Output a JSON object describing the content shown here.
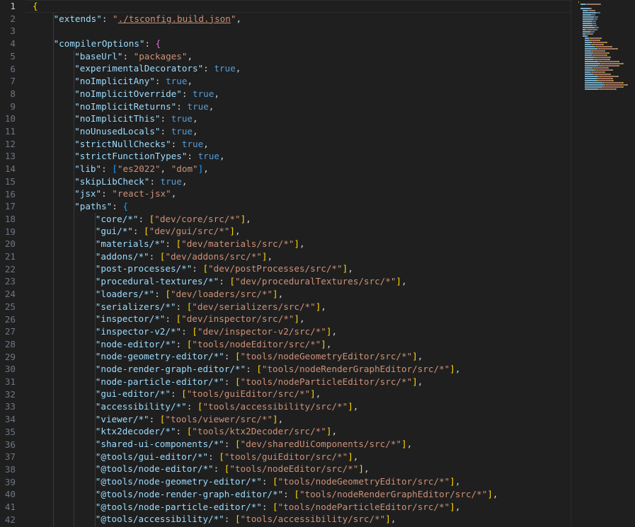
{
  "editor": {
    "active_line": 1,
    "lines": [
      {
        "n": "1",
        "indent": 0,
        "parts": [
          [
            "br1",
            "{"
          ]
        ]
      },
      {
        "n": "2",
        "indent": 1,
        "parts": [
          [
            "k",
            "\"extends\""
          ],
          [
            "p",
            ": "
          ],
          [
            "s",
            "\""
          ],
          [
            "su",
            "./tsconfig.build.json"
          ],
          [
            "s",
            "\""
          ],
          [
            "p",
            ","
          ]
        ]
      },
      {
        "n": "3",
        "indent": 0,
        "parts": []
      },
      {
        "n": "4",
        "indent": 1,
        "parts": [
          [
            "k",
            "\"compilerOptions\""
          ],
          [
            "p",
            ": "
          ],
          [
            "br2",
            "{"
          ]
        ]
      },
      {
        "n": "5",
        "indent": 2,
        "parts": [
          [
            "k",
            "\"baseUrl\""
          ],
          [
            "p",
            ": "
          ],
          [
            "s",
            "\"packages\""
          ],
          [
            "p",
            ","
          ]
        ]
      },
      {
        "n": "6",
        "indent": 2,
        "parts": [
          [
            "k",
            "\"experimentalDecorators\""
          ],
          [
            "p",
            ": "
          ],
          [
            "b",
            "true"
          ],
          [
            "p",
            ","
          ]
        ]
      },
      {
        "n": "7",
        "indent": 2,
        "parts": [
          [
            "k",
            "\"noImplicitAny\""
          ],
          [
            "p",
            ": "
          ],
          [
            "b",
            "true"
          ],
          [
            "p",
            ","
          ]
        ]
      },
      {
        "n": "8",
        "indent": 2,
        "parts": [
          [
            "k",
            "\"noImplicitOverride\""
          ],
          [
            "p",
            ": "
          ],
          [
            "b",
            "true"
          ],
          [
            "p",
            ","
          ]
        ]
      },
      {
        "n": "9",
        "indent": 2,
        "parts": [
          [
            "k",
            "\"noImplicitReturns\""
          ],
          [
            "p",
            ": "
          ],
          [
            "b",
            "true"
          ],
          [
            "p",
            ","
          ]
        ]
      },
      {
        "n": "10",
        "indent": 2,
        "parts": [
          [
            "k",
            "\"noImplicitThis\""
          ],
          [
            "p",
            ": "
          ],
          [
            "b",
            "true"
          ],
          [
            "p",
            ","
          ]
        ]
      },
      {
        "n": "11",
        "indent": 2,
        "parts": [
          [
            "k",
            "\"noUnusedLocals\""
          ],
          [
            "p",
            ": "
          ],
          [
            "b",
            "true"
          ],
          [
            "p",
            ","
          ]
        ]
      },
      {
        "n": "12",
        "indent": 2,
        "parts": [
          [
            "k",
            "\"strictNullChecks\""
          ],
          [
            "p",
            ": "
          ],
          [
            "b",
            "true"
          ],
          [
            "p",
            ","
          ]
        ]
      },
      {
        "n": "13",
        "indent": 2,
        "parts": [
          [
            "k",
            "\"strictFunctionTypes\""
          ],
          [
            "p",
            ": "
          ],
          [
            "b",
            "true"
          ],
          [
            "p",
            ","
          ]
        ]
      },
      {
        "n": "14",
        "indent": 2,
        "parts": [
          [
            "k",
            "\"lib\""
          ],
          [
            "p",
            ": "
          ],
          [
            "br3",
            "["
          ],
          [
            "s",
            "\"es2022\""
          ],
          [
            "p",
            ", "
          ],
          [
            "s",
            "\"dom\""
          ],
          [
            "br3",
            "]"
          ],
          [
            "p",
            ","
          ]
        ]
      },
      {
        "n": "15",
        "indent": 2,
        "parts": [
          [
            "k",
            "\"skipLibCheck\""
          ],
          [
            "p",
            ": "
          ],
          [
            "b",
            "true"
          ],
          [
            "p",
            ","
          ]
        ]
      },
      {
        "n": "16",
        "indent": 2,
        "parts": [
          [
            "k",
            "\"jsx\""
          ],
          [
            "p",
            ": "
          ],
          [
            "s",
            "\"react-jsx\""
          ],
          [
            "p",
            ","
          ]
        ]
      },
      {
        "n": "17",
        "indent": 2,
        "parts": [
          [
            "k",
            "\"paths\""
          ],
          [
            "p",
            ": "
          ],
          [
            "br3",
            "{"
          ]
        ]
      },
      {
        "n": "18",
        "indent": 3,
        "parts": [
          [
            "k",
            "\"core/*\""
          ],
          [
            "p",
            ": "
          ],
          [
            "br1",
            "["
          ],
          [
            "s",
            "\"dev/core/src/*\""
          ],
          [
            "br1",
            "]"
          ],
          [
            "p",
            ","
          ]
        ]
      },
      {
        "n": "19",
        "indent": 3,
        "parts": [
          [
            "k",
            "\"gui/*\""
          ],
          [
            "p",
            ": "
          ],
          [
            "br1",
            "["
          ],
          [
            "s",
            "\"dev/gui/src/*\""
          ],
          [
            "br1",
            "]"
          ],
          [
            "p",
            ","
          ]
        ]
      },
      {
        "n": "20",
        "indent": 3,
        "parts": [
          [
            "k",
            "\"materials/*\""
          ],
          [
            "p",
            ": "
          ],
          [
            "br1",
            "["
          ],
          [
            "s",
            "\"dev/materials/src/*\""
          ],
          [
            "br1",
            "]"
          ],
          [
            "p",
            ","
          ]
        ]
      },
      {
        "n": "21",
        "indent": 3,
        "parts": [
          [
            "k",
            "\"addons/*\""
          ],
          [
            "p",
            ": "
          ],
          [
            "br1",
            "["
          ],
          [
            "s",
            "\"dev/addons/src/*\""
          ],
          [
            "br1",
            "]"
          ],
          [
            "p",
            ","
          ]
        ]
      },
      {
        "n": "22",
        "indent": 3,
        "parts": [
          [
            "k",
            "\"post-processes/*\""
          ],
          [
            "p",
            ": "
          ],
          [
            "br1",
            "["
          ],
          [
            "s",
            "\"dev/postProcesses/src/*\""
          ],
          [
            "br1",
            "]"
          ],
          [
            "p",
            ","
          ]
        ]
      },
      {
        "n": "23",
        "indent": 3,
        "parts": [
          [
            "k",
            "\"procedural-textures/*\""
          ],
          [
            "p",
            ": "
          ],
          [
            "br1",
            "["
          ],
          [
            "s",
            "\"dev/proceduralTextures/src/*\""
          ],
          [
            "br1",
            "]"
          ],
          [
            "p",
            ","
          ]
        ]
      },
      {
        "n": "24",
        "indent": 3,
        "parts": [
          [
            "k",
            "\"loaders/*\""
          ],
          [
            "p",
            ": "
          ],
          [
            "br1",
            "["
          ],
          [
            "s",
            "\"dev/loaders/src/*\""
          ],
          [
            "br1",
            "]"
          ],
          [
            "p",
            ","
          ]
        ]
      },
      {
        "n": "25",
        "indent": 3,
        "parts": [
          [
            "k",
            "\"serializers/*\""
          ],
          [
            "p",
            ": "
          ],
          [
            "br1",
            "["
          ],
          [
            "s",
            "\"dev/serializers/src/*\""
          ],
          [
            "br1",
            "]"
          ],
          [
            "p",
            ","
          ]
        ]
      },
      {
        "n": "26",
        "indent": 3,
        "parts": [
          [
            "k",
            "\"inspector/*\""
          ],
          [
            "p",
            ": "
          ],
          [
            "br1",
            "["
          ],
          [
            "s",
            "\"dev/inspector/src/*\""
          ],
          [
            "br1",
            "]"
          ],
          [
            "p",
            ","
          ]
        ]
      },
      {
        "n": "27",
        "indent": 3,
        "parts": [
          [
            "k",
            "\"inspector-v2/*\""
          ],
          [
            "p",
            ": "
          ],
          [
            "br1",
            "["
          ],
          [
            "s",
            "\"dev/inspector-v2/src/*\""
          ],
          [
            "br1",
            "]"
          ],
          [
            "p",
            ","
          ]
        ]
      },
      {
        "n": "28",
        "indent": 3,
        "parts": [
          [
            "k",
            "\"node-editor/*\""
          ],
          [
            "p",
            ": "
          ],
          [
            "br1",
            "["
          ],
          [
            "s",
            "\"tools/nodeEditor/src/*\""
          ],
          [
            "br1",
            "]"
          ],
          [
            "p",
            ","
          ]
        ]
      },
      {
        "n": "29",
        "indent": 3,
        "parts": [
          [
            "k",
            "\"node-geometry-editor/*\""
          ],
          [
            "p",
            ": "
          ],
          [
            "br1",
            "["
          ],
          [
            "s",
            "\"tools/nodeGeometryEditor/src/*\""
          ],
          [
            "br1",
            "]"
          ],
          [
            "p",
            ","
          ]
        ]
      },
      {
        "n": "30",
        "indent": 3,
        "parts": [
          [
            "k",
            "\"node-render-graph-editor/*\""
          ],
          [
            "p",
            ": "
          ],
          [
            "br1",
            "["
          ],
          [
            "s",
            "\"tools/nodeRenderGraphEditor/src/*\""
          ],
          [
            "br1",
            "]"
          ],
          [
            "p",
            ","
          ]
        ]
      },
      {
        "n": "31",
        "indent": 3,
        "parts": [
          [
            "k",
            "\"node-particle-editor/*\""
          ],
          [
            "p",
            ": "
          ],
          [
            "br1",
            "["
          ],
          [
            "s",
            "\"tools/nodeParticleEditor/src/*\""
          ],
          [
            "br1",
            "]"
          ],
          [
            "p",
            ","
          ]
        ]
      },
      {
        "n": "32",
        "indent": 3,
        "parts": [
          [
            "k",
            "\"gui-editor/*\""
          ],
          [
            "p",
            ": "
          ],
          [
            "br1",
            "["
          ],
          [
            "s",
            "\"tools/guiEditor/src/*\""
          ],
          [
            "br1",
            "]"
          ],
          [
            "p",
            ","
          ]
        ]
      },
      {
        "n": "33",
        "indent": 3,
        "parts": [
          [
            "k",
            "\"accessibility/*\""
          ],
          [
            "p",
            ": "
          ],
          [
            "br1",
            "["
          ],
          [
            "s",
            "\"tools/accessibility/src/*\""
          ],
          [
            "br1",
            "]"
          ],
          [
            "p",
            ","
          ]
        ]
      },
      {
        "n": "34",
        "indent": 3,
        "parts": [
          [
            "k",
            "\"viewer/*\""
          ],
          [
            "p",
            ": "
          ],
          [
            "br1",
            "["
          ],
          [
            "s",
            "\"tools/viewer/src/*\""
          ],
          [
            "br1",
            "]"
          ],
          [
            "p",
            ","
          ]
        ]
      },
      {
        "n": "35",
        "indent": 3,
        "parts": [
          [
            "k",
            "\"ktx2decoder/*\""
          ],
          [
            "p",
            ": "
          ],
          [
            "br1",
            "["
          ],
          [
            "s",
            "\"tools/ktx2Decoder/src/*\""
          ],
          [
            "br1",
            "]"
          ],
          [
            "p",
            ","
          ]
        ]
      },
      {
        "n": "36",
        "indent": 3,
        "parts": [
          [
            "k",
            "\"shared-ui-components/*\""
          ],
          [
            "p",
            ": "
          ],
          [
            "br1",
            "["
          ],
          [
            "s",
            "\"dev/sharedUiComponents/src/*\""
          ],
          [
            "br1",
            "]"
          ],
          [
            "p",
            ","
          ]
        ]
      },
      {
        "n": "37",
        "indent": 3,
        "parts": [
          [
            "k",
            "\"@tools/gui-editor/*\""
          ],
          [
            "p",
            ": "
          ],
          [
            "br1",
            "["
          ],
          [
            "s",
            "\"tools/guiEditor/src/*\""
          ],
          [
            "br1",
            "]"
          ],
          [
            "p",
            ","
          ]
        ]
      },
      {
        "n": "38",
        "indent": 3,
        "parts": [
          [
            "k",
            "\"@tools/node-editor/*\""
          ],
          [
            "p",
            ": "
          ],
          [
            "br1",
            "["
          ],
          [
            "s",
            "\"tools/nodeEditor/src/*\""
          ],
          [
            "br1",
            "]"
          ],
          [
            "p",
            ","
          ]
        ]
      },
      {
        "n": "39",
        "indent": 3,
        "parts": [
          [
            "k",
            "\"@tools/node-geometry-editor/*\""
          ],
          [
            "p",
            ": "
          ],
          [
            "br1",
            "["
          ],
          [
            "s",
            "\"tools/nodeGeometryEditor/src/*\""
          ],
          [
            "br1",
            "]"
          ],
          [
            "p",
            ","
          ]
        ]
      },
      {
        "n": "40",
        "indent": 3,
        "parts": [
          [
            "k",
            "\"@tools/node-render-graph-editor/*\""
          ],
          [
            "p",
            ": "
          ],
          [
            "br1",
            "["
          ],
          [
            "s",
            "\"tools/nodeRenderGraphEditor/src/*\""
          ],
          [
            "br1",
            "]"
          ],
          [
            "p",
            ","
          ]
        ]
      },
      {
        "n": "41",
        "indent": 3,
        "parts": [
          [
            "k",
            "\"@tools/node-particle-editor/*\""
          ],
          [
            "p",
            ": "
          ],
          [
            "br1",
            "["
          ],
          [
            "s",
            "\"tools/nodeParticleEditor/src/*\""
          ],
          [
            "br1",
            "]"
          ],
          [
            "p",
            ","
          ]
        ]
      },
      {
        "n": "42",
        "indent": 3,
        "parts": [
          [
            "k",
            "\"@tools/accessibility/*\""
          ],
          [
            "p",
            ": "
          ],
          [
            "br1",
            "["
          ],
          [
            "s",
            "\"tools/accessibility/src/*\""
          ],
          [
            "br1",
            "]"
          ],
          [
            "p",
            ","
          ]
        ]
      }
    ]
  },
  "colors": {
    "background": "#1f1f1f",
    "key": "#9cdcfe",
    "string": "#ce9178",
    "boolean": "#569cd6",
    "bracket_gold": "#ffd700",
    "bracket_purple": "#da70d6",
    "bracket_blue": "#179fff",
    "line_number": "#6e7681"
  }
}
